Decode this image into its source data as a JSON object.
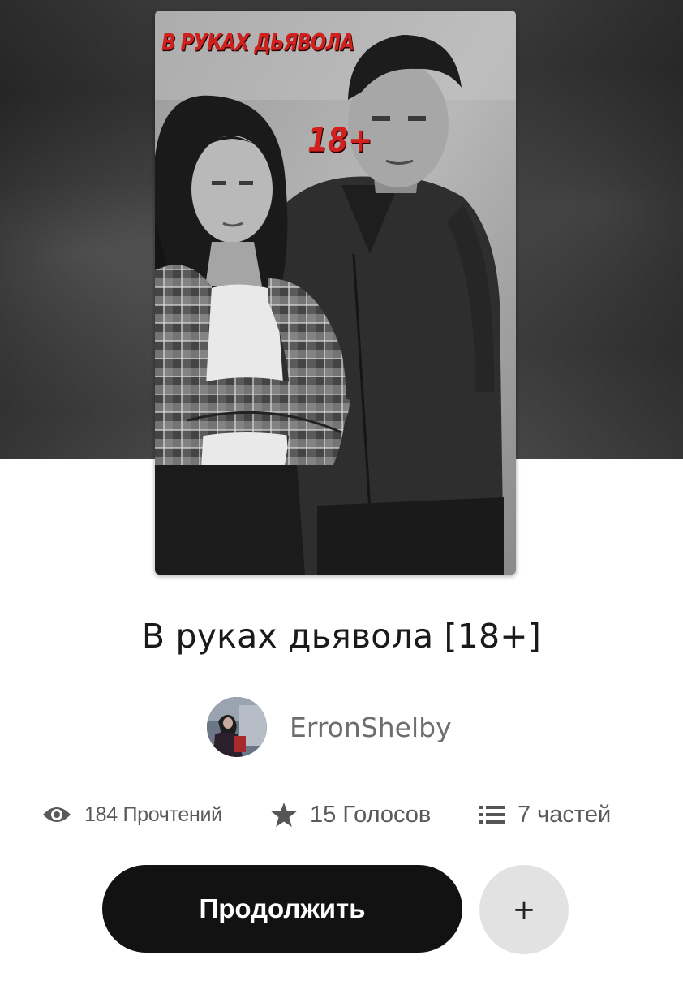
{
  "book": {
    "cover_title": "В РУКАХ ДЬЯВОЛА",
    "cover_age": "18+",
    "title": "В руках дьявола [18+]"
  },
  "author": {
    "name": "ErronShelby"
  },
  "stats": {
    "reads": {
      "icon": "eye-icon",
      "label": "184 Прочтений"
    },
    "votes": {
      "icon": "star-icon",
      "label": "15 Голосов"
    },
    "parts": {
      "icon": "list-icon",
      "label": "7 частей"
    }
  },
  "actions": {
    "continue_label": "Продолжить",
    "add_label": "+"
  },
  "colors": {
    "button_dark": "#121212",
    "add_button_bg": "#e2e2e2",
    "cover_text_red": "#d0211e",
    "muted_text": "#6d6d6d"
  }
}
